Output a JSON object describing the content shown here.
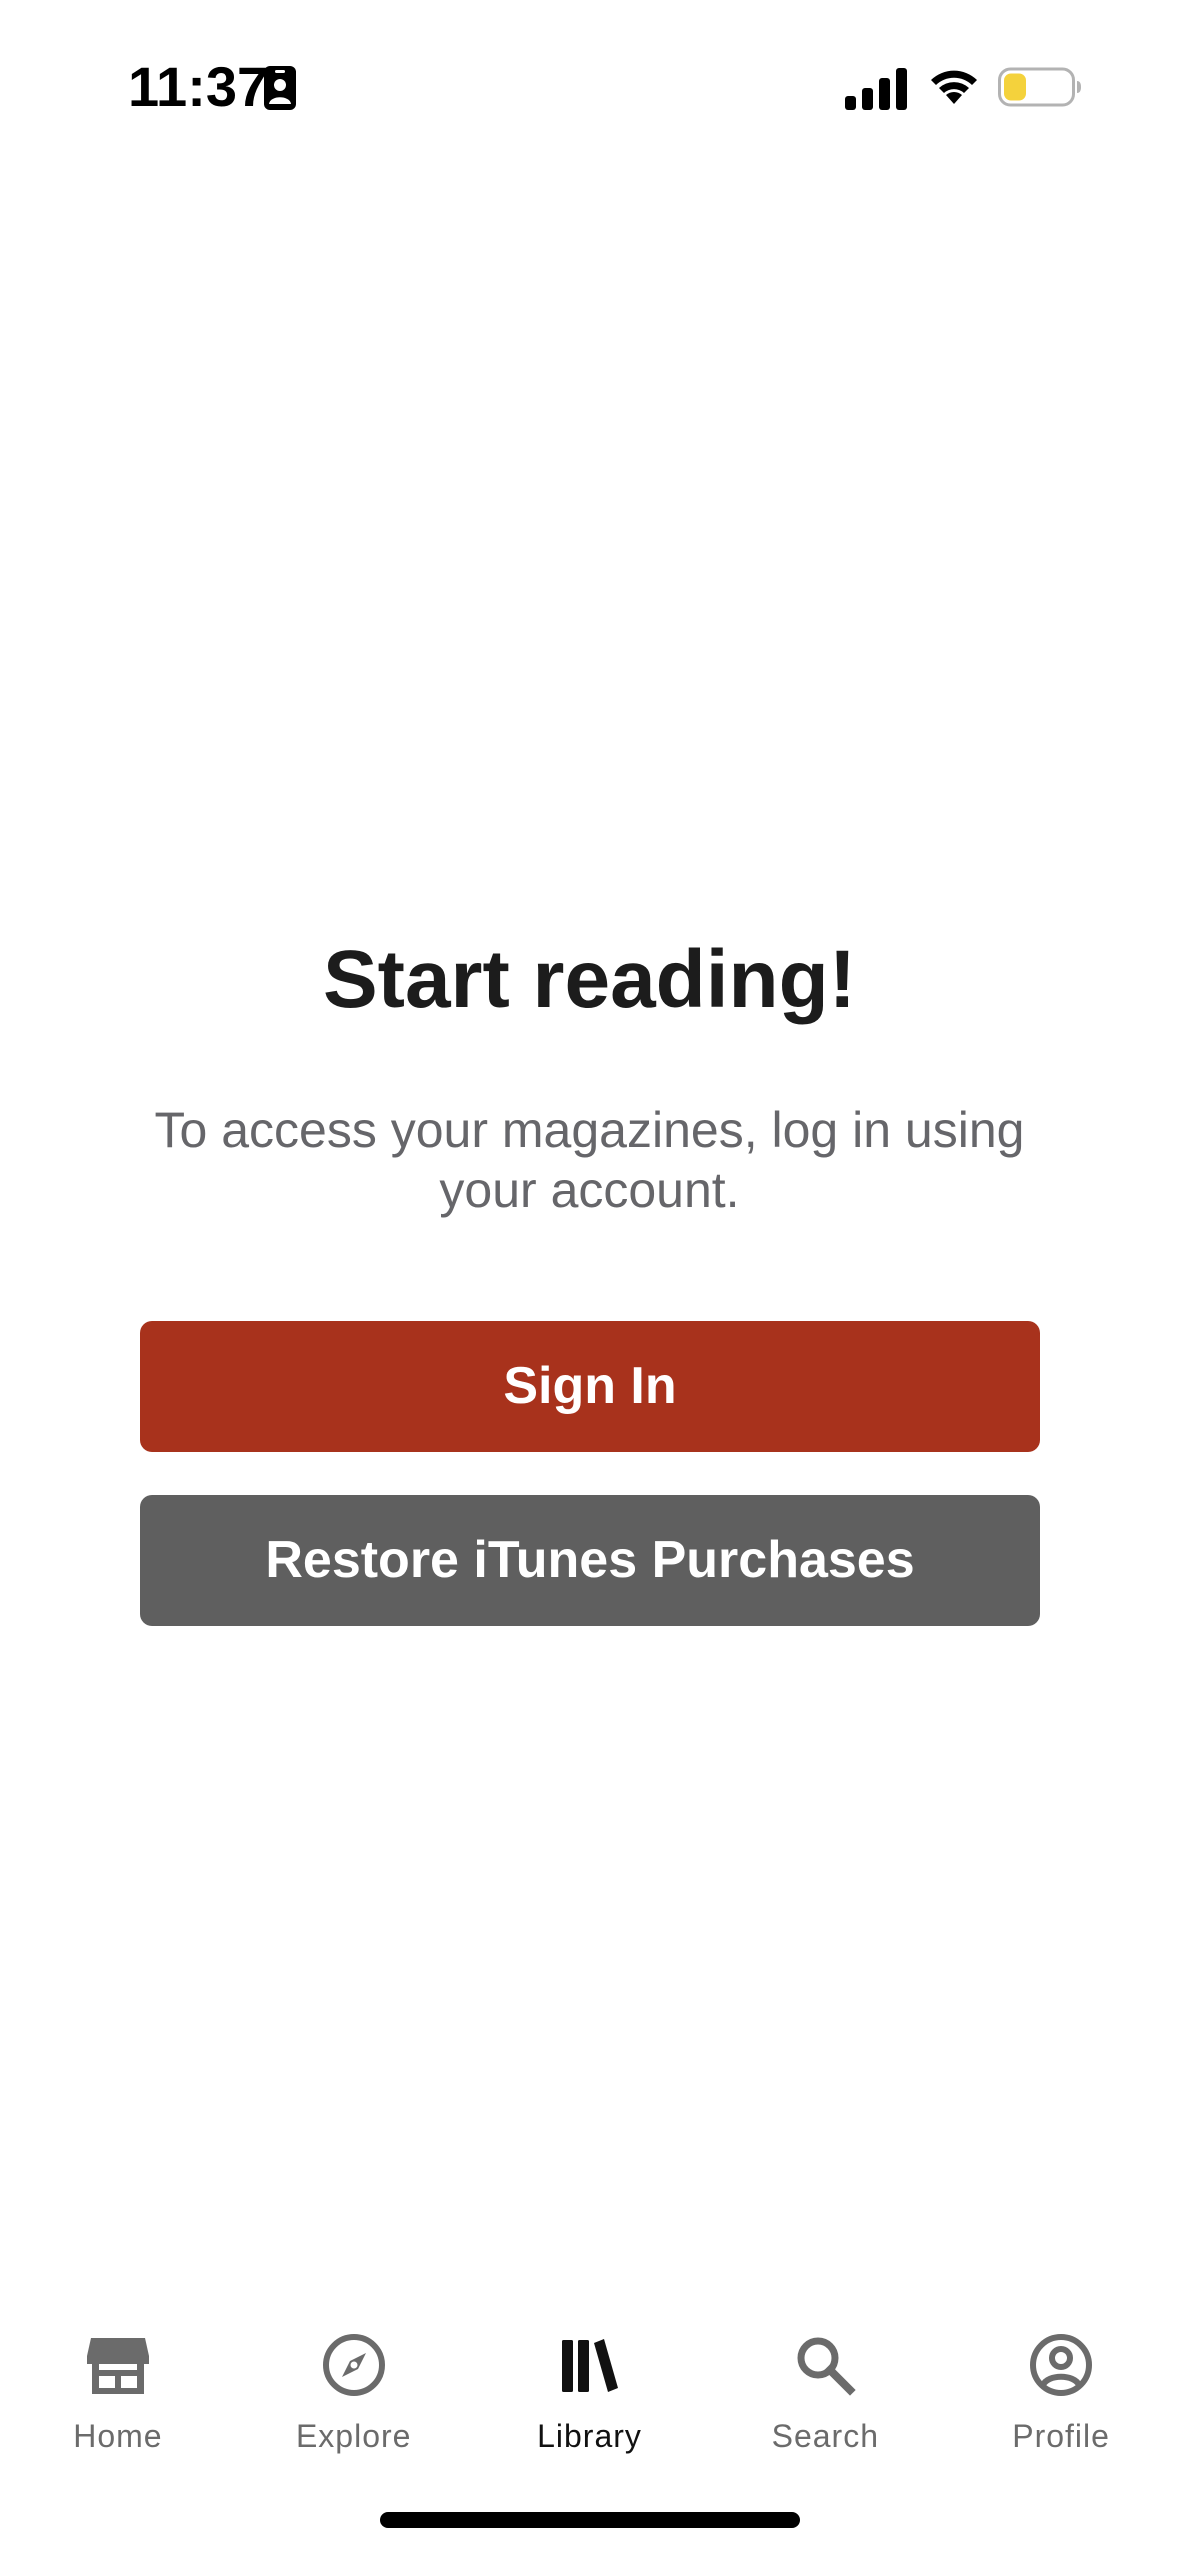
{
  "status_bar": {
    "time": "11:37",
    "icons": [
      "badge-icon",
      "signal-icon",
      "wifi-icon",
      "battery-icon"
    ],
    "battery_color": "#f4d23c"
  },
  "main": {
    "headline": "Start reading!",
    "subtext": "To access your magazines, log in using your account.",
    "signin_label": "Sign In",
    "restore_label": "Restore iTunes Purchases"
  },
  "colors": {
    "signin_button": "#a8321c",
    "restore_button": "#5f5f5f",
    "tab_inactive": "#6b6b6b",
    "tab_active": "#111111"
  },
  "tabs": [
    {
      "label": "Home",
      "icon": "store-icon",
      "active": false
    },
    {
      "label": "Explore",
      "icon": "compass-icon",
      "active": false
    },
    {
      "label": "Library",
      "icon": "library-icon",
      "active": true
    },
    {
      "label": "Search",
      "icon": "search-icon",
      "active": false
    },
    {
      "label": "Profile",
      "icon": "profile-icon",
      "active": false
    }
  ]
}
